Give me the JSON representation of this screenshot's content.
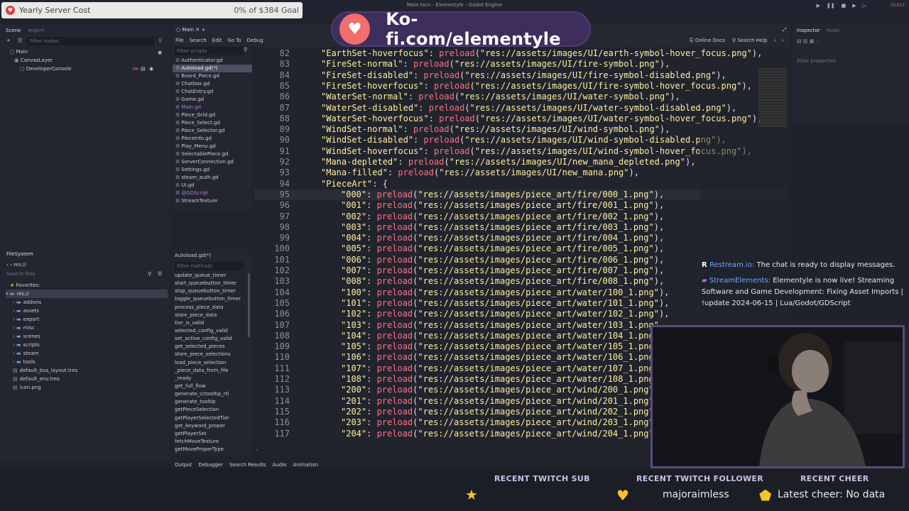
{
  "window": {
    "title": "Main.tscn - Elementyle - Godot Engine",
    "renderer": "GLES3"
  },
  "overlay": {
    "server_cost": {
      "title": "Yearly Server Cost",
      "progress_text": "0% of $384 Goal",
      "progress": 0
    },
    "kofi": {
      "text": "Ko-fi.com/elementyle"
    }
  },
  "scene_dock": {
    "tabs": [
      "Scene",
      "Import"
    ],
    "filter_placeholder": "Filter nodes",
    "nodes": [
      "Main",
      "CanvasLayer",
      "DeveloperConsole"
    ]
  },
  "script_editor": {
    "tab": "Main",
    "menu": [
      "File",
      "Search",
      "Edit",
      "Go To",
      "Debug"
    ],
    "filter_scripts_placeholder": "Filter scripts",
    "scripts": [
      "Authenticator.gd",
      "Autoload.gd(*)",
      "Board_Piece.gd",
      "Chatbox.gd",
      "ChatEntry.gd",
      "Game.gd",
      "Main.gd",
      "Piece_Grid.gd",
      "Piece_Select.gd",
      "Piece_Selector.gd",
      "PieceInfo.gd",
      "Play_Menu.gd",
      "SelectablePiece.gd",
      "ServerConnection.gd",
      "Settings.gd",
      "steam_auth.gd",
      "UI.gd",
      "@GDScript",
      "StreamTexture"
    ],
    "current_script": "Autoload.gd(*)",
    "filter_methods_placeholder": "Filter methods",
    "methods": [
      "update_queue_timer",
      "start_queuebutton_timer",
      "stop_queuebutton_timer",
      "toggle_queuebutton_timer",
      "process_piece_data",
      "store_piece_data",
      "tier_is_valid",
      "selected_config_valid",
      "set_active_config_valid",
      "get_selected_pieces",
      "store_piece_selections",
      "load_piece_selection",
      "_piece_data_from_file",
      "_ready",
      "get_full_flow",
      "generate_cctooltip_rtl",
      "generate_tooltip",
      "getPieceSelection",
      "getPlayerSelectedTier",
      "get_keyword_proper",
      "getPlayerSet",
      "fetchMoveTexture",
      "getMoveProperType"
    ],
    "online_docs": "Online Docs",
    "search_help": "Search Help"
  },
  "code": {
    "lines": [
      {
        "n": "82",
        "key": "\"EarthSet-hoverfocus\"",
        "path": "\"res://assets/images/UI/earth-symbol-hover_focus.png\"",
        "end": "),"
      },
      {
        "n": "83",
        "key": "\"FireSet-normal\"",
        "path": "\"res://assets/images/UI/fire-symbol.png\"",
        "end": "),"
      },
      {
        "n": "84",
        "key": "\"FireSet-disabled\"",
        "path": "\"res://assets/images/UI/fire-symbol-disabled.png\"",
        "end": "),"
      },
      {
        "n": "85",
        "key": "\"FireSet-hoverfocus\"",
        "path": "\"res://assets/images/UI/fire-symbol-hover_focus.png\"",
        "end": "),"
      },
      {
        "n": "86",
        "key": "\"WaterSet-normal\"",
        "path": "\"res://assets/images/UI/water-symbol.png\"",
        "end": "),"
      },
      {
        "n": "87",
        "key": "\"WaterSet-disabled\"",
        "path": "\"res://assets/images/UI/water-symbol-disabled.png\"",
        "end": "),"
      },
      {
        "n": "88",
        "key": "\"WaterSet-hoverfocus\"",
        "path": "\"res://assets/images/UI/water-symbol-hover_focus.png\"",
        "end": "),"
      },
      {
        "n": "89",
        "key": "\"WindSet-normal\"",
        "path": "\"res://assets/images/UI/wind-symbol.png\"",
        "end": "),"
      },
      {
        "n": "90",
        "key": "\"WindSet-disabled\"",
        "path": "\"res://assets/images/UI/wind-symbol-disabled.png\"",
        "end": "),"
      },
      {
        "n": "91",
        "key": "\"WindSet-hoverfocus\"",
        "path": "\"res://assets/images/UI/wind-symbol-hover_focus.png\"",
        "end": "),"
      },
      {
        "n": "92",
        "key": "\"Mana-depleted\"",
        "path": "\"res://assets/images/UI/new_mana_depleted.png\"",
        "end": "),"
      },
      {
        "n": "93",
        "key": "\"Mana-filled\"",
        "path": "\"res://assets/images/UI/new_mana.png\"",
        "end": "),"
      },
      {
        "n": "94",
        "key": "\"PieceArt\"",
        "path": "",
        "end": ": {"
      },
      {
        "n": "95",
        "key": "\"000\"",
        "path": "\"res://assets/images/piece_art/fire/000_1.png\"",
        "end": "),"
      },
      {
        "n": "96",
        "key": "\"001\"",
        "path": "\"res://assets/images/piece_art/fire/001_1.png\"",
        "end": "),"
      },
      {
        "n": "97",
        "key": "\"002\"",
        "path": "\"res://assets/images/piece_art/fire/002_1.png\"",
        "end": "),"
      },
      {
        "n": "98",
        "key": "\"003\"",
        "path": "\"res://assets/images/piece_art/fire/003_1.png\"",
        "end": "),"
      },
      {
        "n": "99",
        "key": "\"004\"",
        "path": "\"res://assets/images/piece_art/fire/004_1.png\"",
        "end": "),"
      },
      {
        "n": "100",
        "key": "\"005\"",
        "path": "\"res://assets/images/piece_art/fire/005_1.png\"",
        "end": "),"
      },
      {
        "n": "101",
        "key": "\"006\"",
        "path": "\"res://assets/images/piece_art/fire/006_1.png\"",
        "end": "),"
      },
      {
        "n": "102",
        "key": "\"007\"",
        "path": "\"res://assets/images/piece_art/fire/007_1.png\"",
        "end": "),"
      },
      {
        "n": "103",
        "key": "\"008\"",
        "path": "\"res://assets/images/piece_art/fire/008_1.png\"",
        "end": "),"
      },
      {
        "n": "104",
        "key": "\"100\"",
        "path": "\"res://assets/images/piece_art/water/100_1.png\"",
        "end": "),"
      },
      {
        "n": "105",
        "key": "\"101\"",
        "path": "\"res://assets/images/piece_art/water/101_1.png\"",
        "end": "),"
      },
      {
        "n": "106",
        "key": "\"102\"",
        "path": "\"res://assets/images/piece_art/water/102_1.png\"",
        "end": "),"
      },
      {
        "n": "107",
        "key": "\"103\"",
        "path": "\"res://assets/images/piece_art/water/103_1.png\"",
        "end": ""
      },
      {
        "n": "108",
        "key": "\"104\"",
        "path": "\"res://assets/images/piece_art/water/104_1.png\"",
        "end": ""
      },
      {
        "n": "109",
        "key": "\"105\"",
        "path": "\"res://assets/images/piece_art/water/105_1.png\"",
        "end": ""
      },
      {
        "n": "110",
        "key": "\"106\"",
        "path": "\"res://assets/images/piece_art/water/106_1.png\"",
        "end": ""
      },
      {
        "n": "111",
        "key": "\"107\"",
        "path": "\"res://assets/images/piece_art/water/107_1.png\"",
        "end": ""
      },
      {
        "n": "112",
        "key": "\"108\"",
        "path": "\"res://assets/images/piece_art/water/108_1.png\"",
        "end": ""
      },
      {
        "n": "113",
        "key": "\"200\"",
        "path": "\"res://assets/images/piece_art/wind/200_1.png\"",
        "end": ")"
      },
      {
        "n": "114",
        "key": "\"201\"",
        "path": "\"res://assets/images/piece_art/wind/201_1.png\"",
        "end": ")"
      },
      {
        "n": "115",
        "key": "\"202\"",
        "path": "\"res://assets/images/piece_art/wind/202_1.png\"",
        "end": ")"
      },
      {
        "n": "116",
        "key": "\"203\"",
        "path": "\"res://assets/images/piece_art/wind/203_1.png\"",
        "end": ")"
      },
      {
        "n": "117",
        "key": "\"204\"",
        "path": "\"res://assets/images/piece_art/wind/204_1.png\"",
        "end": ")"
      }
    ],
    "keyword": "preload"
  },
  "filesystem": {
    "title": "FileSystem",
    "path": "res://",
    "search_placeholder": "Search files",
    "favorites": "Favorites:",
    "root": "res://",
    "folders": [
      "addons",
      "assets",
      "export",
      "misc",
      "scenes",
      "scripts",
      "steam",
      "tools"
    ],
    "files": [
      "default_bus_layout.tres",
      "default_env.tres",
      "icon.png"
    ]
  },
  "inspector": {
    "tabs": [
      "Inspector",
      "Node"
    ],
    "filter_placeholder": "Filter properties"
  },
  "bottom_panel": {
    "tabs": [
      "Output",
      "Debugger",
      "Search Results",
      "Audio",
      "Animation"
    ]
  },
  "chat": {
    "messages": [
      {
        "name": "Restream.io:",
        "text": "The chat is ready to display messages."
      },
      {
        "name": "StreamElements:",
        "text": "Elementyle is now live! Streaming Software and Game Development: Fixing Asset Imports | !update 2024-06-15 | Lua/Godot/GDScript"
      }
    ]
  },
  "stream_bar": {
    "sub_heading": "RECENT TWITCH SUB",
    "follower_heading": "RECENT TWITCH FOLLOWER",
    "follower": "majoraimless",
    "cheer_heading": "RECENT CHEER",
    "cheer": "Latest cheer: No data"
  },
  "colors": {
    "string": "#ffeda1",
    "keyword": "#57b3ff",
    "function": "#ff7085",
    "accent": "#5a4b78"
  }
}
